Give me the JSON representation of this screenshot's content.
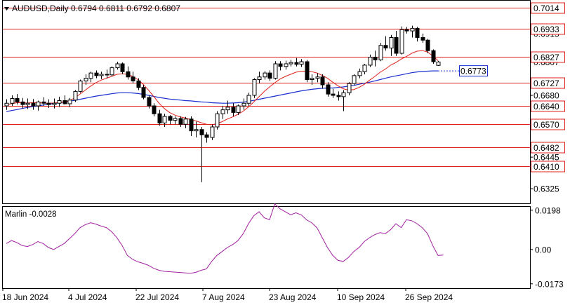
{
  "main_title": "AUDUSD,Daily  0.6794  0.6811  0.6792  0.6807",
  "indicator_title": "Marlin -0.0028",
  "colors": {
    "level_line": "#e0201a",
    "level_box": "#e0201a",
    "ma_fast": "#e0201a",
    "ma_slow": "#1a2fd0",
    "marlin": "#a020a0",
    "candle": "#000000",
    "grid_border": "#000000"
  },
  "chart_data": [
    {
      "type": "candlestick",
      "symbol": "AUDUSD",
      "timeframe": "Daily",
      "ohlc_header": [
        0.6794,
        0.6811,
        0.6792,
        0.6807
      ],
      "ylim": [
        0.6272,
        0.704
      ],
      "price_ticks": [
        "0.6915",
        "0.6807",
        "0.6680",
        "0.6570",
        "0.6445",
        "0.6325"
      ],
      "current_price_label": "0.6807",
      "x_labels": [
        "18 Jun 2024",
        "4 Jul 2024",
        "22 Jul 2024",
        "7 Aug 2024",
        "23 Aug 2024",
        "10 Sep 2024",
        "26 Sep 2024"
      ],
      "levels": [
        {
          "price": 0.7014,
          "label": "0.7014"
        },
        {
          "price": 0.6933,
          "label": "0.6933"
        },
        {
          "price": 0.6827,
          "label": "0.6827"
        },
        {
          "price": 0.6727,
          "label": "0.6727"
        },
        {
          "price": 0.664,
          "label": "0.6640"
        },
        {
          "price": 0.657,
          "label": "0.6570"
        },
        {
          "price": 0.6482,
          "label": "0.6482"
        },
        {
          "price": 0.641,
          "label": "0.6410"
        }
      ],
      "ma_value_label": "0.6773",
      "candles": [
        [
          0.664,
          0.6665,
          0.6625,
          0.665
        ],
        [
          0.665,
          0.668,
          0.664,
          0.6668
        ],
        [
          0.6668,
          0.6685,
          0.6645,
          0.6655
        ],
        [
          0.6655,
          0.667,
          0.663,
          0.6645
        ],
        [
          0.6645,
          0.6668,
          0.6628,
          0.665
        ],
        [
          0.665,
          0.6666,
          0.6625,
          0.664
        ],
        [
          0.664,
          0.666,
          0.6622,
          0.6655
        ],
        [
          0.6655,
          0.6673,
          0.664,
          0.665
        ],
        [
          0.665,
          0.6665,
          0.6632,
          0.6645
        ],
        [
          0.6645,
          0.6668,
          0.663,
          0.665
        ],
        [
          0.665,
          0.6675,
          0.6636,
          0.666
        ],
        [
          0.666,
          0.668,
          0.6645,
          0.6648
        ],
        [
          0.6648,
          0.667,
          0.6635,
          0.6662
        ],
        [
          0.6662,
          0.67,
          0.6655,
          0.6695
        ],
        [
          0.6695,
          0.674,
          0.669,
          0.6735
        ],
        [
          0.6735,
          0.676,
          0.672,
          0.6745
        ],
        [
          0.6745,
          0.677,
          0.673,
          0.6765
        ],
        [
          0.6765,
          0.6775,
          0.6745,
          0.6755
        ],
        [
          0.6755,
          0.677,
          0.6742,
          0.676
        ],
        [
          0.676,
          0.6778,
          0.6745,
          0.6758
        ],
        [
          0.6758,
          0.679,
          0.6752,
          0.6785
        ],
        [
          0.6785,
          0.6808,
          0.6778,
          0.68
        ],
        [
          0.68,
          0.6805,
          0.676,
          0.677
        ],
        [
          0.677,
          0.679,
          0.674,
          0.675
        ],
        [
          0.675,
          0.677,
          0.6725,
          0.6735
        ],
        [
          0.6735,
          0.6745,
          0.67,
          0.671
        ],
        [
          0.671,
          0.672,
          0.6665,
          0.6672
        ],
        [
          0.6672,
          0.668,
          0.663,
          0.664
        ],
        [
          0.664,
          0.665,
          0.66,
          0.661
        ],
        [
          0.661,
          0.6625,
          0.6565,
          0.6575
        ],
        [
          0.6575,
          0.661,
          0.656,
          0.66
        ],
        [
          0.66,
          0.6605,
          0.657,
          0.6585
        ],
        [
          0.6585,
          0.66,
          0.657,
          0.6592
        ],
        [
          0.6592,
          0.66,
          0.656,
          0.657
        ],
        [
          0.657,
          0.6598,
          0.6555,
          0.659
        ],
        [
          0.659,
          0.66,
          0.6525,
          0.6545
        ],
        [
          0.6545,
          0.658,
          0.652,
          0.655
        ],
        [
          0.655,
          0.656,
          0.635,
          0.653
        ],
        [
          0.653,
          0.654,
          0.65,
          0.652
        ],
        [
          0.652,
          0.657,
          0.651,
          0.656
        ],
        [
          0.656,
          0.662,
          0.655,
          0.661
        ],
        [
          0.661,
          0.664,
          0.659,
          0.6625
        ],
        [
          0.6625,
          0.666,
          0.661,
          0.6635
        ],
        [
          0.6635,
          0.665,
          0.66,
          0.6615
        ],
        [
          0.6615,
          0.6645,
          0.6605,
          0.664
        ],
        [
          0.664,
          0.6668,
          0.6625,
          0.665
        ],
        [
          0.665,
          0.669,
          0.664,
          0.668
        ],
        [
          0.668,
          0.6745,
          0.667,
          0.674
        ],
        [
          0.674,
          0.677,
          0.6725,
          0.675
        ],
        [
          0.675,
          0.6772,
          0.674,
          0.6765
        ],
        [
          0.6765,
          0.6775,
          0.6735,
          0.6745
        ],
        [
          0.6745,
          0.681,
          0.674,
          0.68
        ],
        [
          0.68,
          0.681,
          0.6775,
          0.679
        ],
        [
          0.679,
          0.6812,
          0.6778,
          0.68
        ],
        [
          0.68,
          0.6815,
          0.679,
          0.6805
        ],
        [
          0.6805,
          0.6822,
          0.679,
          0.6798
        ],
        [
          0.6798,
          0.6818,
          0.6788,
          0.6808
        ],
        [
          0.6808,
          0.6815,
          0.673,
          0.674
        ],
        [
          0.674,
          0.676,
          0.672,
          0.6745
        ],
        [
          0.6745,
          0.6765,
          0.673,
          0.675
        ],
        [
          0.675,
          0.676,
          0.6705,
          0.672
        ],
        [
          0.672,
          0.673,
          0.6675,
          0.6685
        ],
        [
          0.6685,
          0.6705,
          0.667,
          0.668
        ],
        [
          0.668,
          0.6695,
          0.666,
          0.6675
        ],
        [
          0.6675,
          0.67,
          0.662,
          0.669
        ],
        [
          0.669,
          0.673,
          0.668,
          0.6725
        ],
        [
          0.6725,
          0.676,
          0.6718,
          0.6755
        ],
        [
          0.6755,
          0.6782,
          0.6745,
          0.677
        ],
        [
          0.677,
          0.68,
          0.676,
          0.6795
        ],
        [
          0.6795,
          0.6835,
          0.6788,
          0.6825
        ],
        [
          0.6825,
          0.685,
          0.679,
          0.6815
        ],
        [
          0.6815,
          0.688,
          0.681,
          0.687
        ],
        [
          0.687,
          0.6905,
          0.685,
          0.686
        ],
        [
          0.686,
          0.691,
          0.683,
          0.69
        ],
        [
          0.69,
          0.6925,
          0.683,
          0.684
        ],
        [
          0.684,
          0.6942,
          0.6835,
          0.693
        ],
        [
          0.693,
          0.694,
          0.6915,
          0.6925
        ],
        [
          0.6925,
          0.6945,
          0.69,
          0.6935
        ],
        [
          0.6935,
          0.694,
          0.6885,
          0.69
        ],
        [
          0.69,
          0.6915,
          0.688,
          0.689
        ],
        [
          0.689,
          0.6895,
          0.684,
          0.685
        ],
        [
          0.685,
          0.6855,
          0.68,
          0.6808
        ],
        [
          0.6794,
          0.6811,
          0.6792,
          0.6807
        ]
      ],
      "ma_fast": [
        0.6645,
        0.6648,
        0.6652,
        0.6652,
        0.6651,
        0.6652,
        0.6652,
        0.6651,
        0.665,
        0.6651,
        0.6653,
        0.6655,
        0.666,
        0.667,
        0.6685,
        0.67,
        0.6715,
        0.6728,
        0.6738,
        0.6745,
        0.6752,
        0.676,
        0.6762,
        0.676,
        0.6752,
        0.674,
        0.6722,
        0.67,
        0.6676,
        0.665,
        0.663,
        0.6615,
        0.6605,
        0.6598,
        0.6594,
        0.6588,
        0.6583,
        0.6576,
        0.657,
        0.6568,
        0.6572,
        0.658,
        0.659,
        0.6598,
        0.6608,
        0.662,
        0.6636,
        0.6655,
        0.6675,
        0.6695,
        0.6712,
        0.6728,
        0.6742,
        0.6752,
        0.676,
        0.6768,
        0.6772,
        0.6772,
        0.677,
        0.6765,
        0.6756,
        0.6745,
        0.673,
        0.6716,
        0.6705,
        0.67,
        0.6702,
        0.671,
        0.6722,
        0.6738,
        0.6752,
        0.6768,
        0.678,
        0.6795,
        0.6805,
        0.6818,
        0.6828,
        0.684,
        0.6848,
        0.685,
        0.6845,
        0.683,
        0.6812
      ],
      "ma_slow": [
        0.6618,
        0.6622,
        0.6626,
        0.663,
        0.6634,
        0.6637,
        0.664,
        0.6643,
        0.6646,
        0.6649,
        0.6652,
        0.6655,
        0.6658,
        0.6661,
        0.6665,
        0.6669,
        0.6673,
        0.6677,
        0.668,
        0.6683,
        0.6686,
        0.6689,
        0.669,
        0.669,
        0.6689,
        0.6687,
        0.6684,
        0.668,
        0.6676,
        0.6672,
        0.6669,
        0.6666,
        0.6664,
        0.6662,
        0.666,
        0.6659,
        0.6657,
        0.6655,
        0.6654,
        0.6652,
        0.6651,
        0.665,
        0.665,
        0.6651,
        0.6652,
        0.6654,
        0.6657,
        0.6661,
        0.6665,
        0.6669,
        0.6673,
        0.6677,
        0.6681,
        0.6685,
        0.6689,
        0.6693,
        0.6697,
        0.67,
        0.6703,
        0.6705,
        0.6707,
        0.6708,
        0.6708,
        0.671,
        0.6712,
        0.6715,
        0.6718,
        0.6722,
        0.6726,
        0.673,
        0.6735,
        0.674,
        0.6745,
        0.675,
        0.6754,
        0.6758,
        0.6762,
        0.6766,
        0.6769,
        0.6771,
        0.6772,
        0.6773,
        0.6773
      ]
    },
    {
      "type": "line",
      "name": "Marlin",
      "ylim": [
        -0.0195,
        0.0215
      ],
      "y_ticks": [
        "0.0198",
        "0.00",
        "-0.0173"
      ],
      "values": [
        0.003,
        0.0045,
        0.0035,
        0.002,
        0.0015,
        0.0025,
        0.004,
        0.003,
        0.001,
        0.0,
        0.0015,
        0.003,
        0.0055,
        0.008,
        0.011,
        0.0125,
        0.0135,
        0.0128,
        0.0118,
        0.011,
        0.009,
        0.006,
        0.002,
        -0.003,
        -0.005,
        -0.0062,
        -0.007,
        -0.008,
        -0.0095,
        -0.0105,
        -0.011,
        -0.0112,
        -0.0114,
        -0.0116,
        -0.0118,
        -0.012,
        -0.0115,
        -0.0105,
        -0.0098,
        -0.006,
        -0.003,
        -0.001,
        0.001,
        0.0025,
        0.0045,
        0.008,
        0.013,
        0.017,
        0.019,
        0.016,
        0.015,
        0.023,
        0.0205,
        0.019,
        0.0175,
        0.0185,
        0.0175,
        0.015,
        0.0135,
        0.011,
        0.006,
        0.001,
        -0.003,
        -0.0055,
        -0.006,
        -0.004,
        -0.001,
        0.001,
        0.004,
        0.006,
        0.0075,
        0.0085,
        0.008,
        0.01,
        0.013,
        0.011,
        0.015,
        0.0145,
        0.013,
        0.011,
        0.008,
        0.002,
        -0.003,
        -0.0028
      ]
    }
  ]
}
